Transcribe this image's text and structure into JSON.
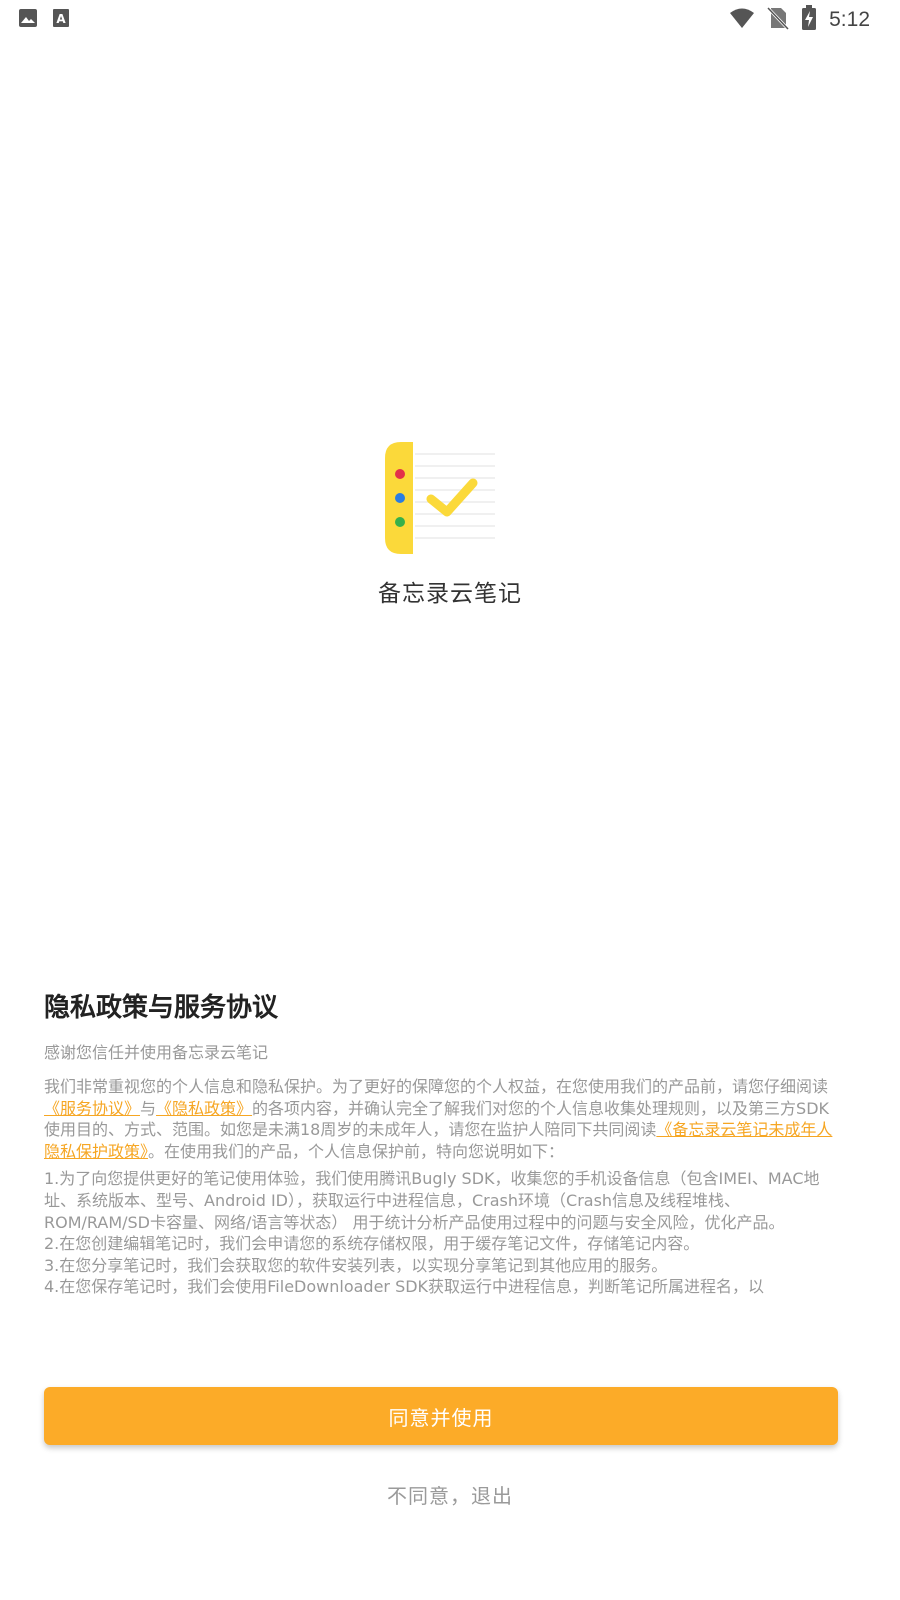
{
  "status_bar": {
    "time": "5:12",
    "icons": [
      "image-icon",
      "keyboard-a-icon",
      "wifi-icon",
      "no-sim-icon",
      "battery-charging-icon"
    ]
  },
  "app": {
    "name": "备忘录云笔记",
    "icon": "notebook-check-icon"
  },
  "privacy_sheet": {
    "title": "隐私政策与服务协议",
    "subtitle": "感谢您信任并使用备忘录云笔记",
    "intro": {
      "text_1": "我们非常重视您的个人信息和隐私保护。为了更好的保障您的个人权益，在您使用我们的产品前，请您仔细阅读",
      "link_service": "《服务协议》",
      "text_2": "与",
      "link_privacy": "《隐私政策》",
      "text_3": "的各项内容，并确认完全了解我们对您的个人信息收集处理规则，以及第三方SDK使用目的、方式、范围。如您是未满18周岁的未成年人，请您在监护人陪同下共同阅读",
      "link_minor": "《备忘录云笔记未成年人隐私保护政策》",
      "text_4": "。在使用我们的产品，个人信息保护前，特向您说明如下："
    },
    "items": [
      "1.为了向您提供更好的笔记使用体验，我们使用腾讯Bugly SDK，收集您的手机设备信息（包含IMEI、MAC地址、系统版本、型号、Android ID），获取运行中进程信息，Crash环境（Crash信息及线程堆栈、ROM/RAM/SD卡容量、网络/语言等状态） 用于统计分析产品使用过程中的问题与安全风险，优化产品。",
      "2.在您创建编辑笔记时，我们会申请您的系统存储权限，用于缓存笔记文件，存储笔记内容。",
      "3.在您分享笔记时，我们会获取您的软件安装列表，以实现分享笔记到其他应用的服务。",
      "4.在您保存笔记时，我们会使用FileDownloader SDK获取运行中进程信息，判断笔记所属进程名，以"
    ],
    "agree_label": "同意并使用",
    "reject_label": "不同意，退出"
  },
  "colors": {
    "accent": "#fcab28",
    "link": "#f6a623",
    "muted_text": "#999999"
  }
}
